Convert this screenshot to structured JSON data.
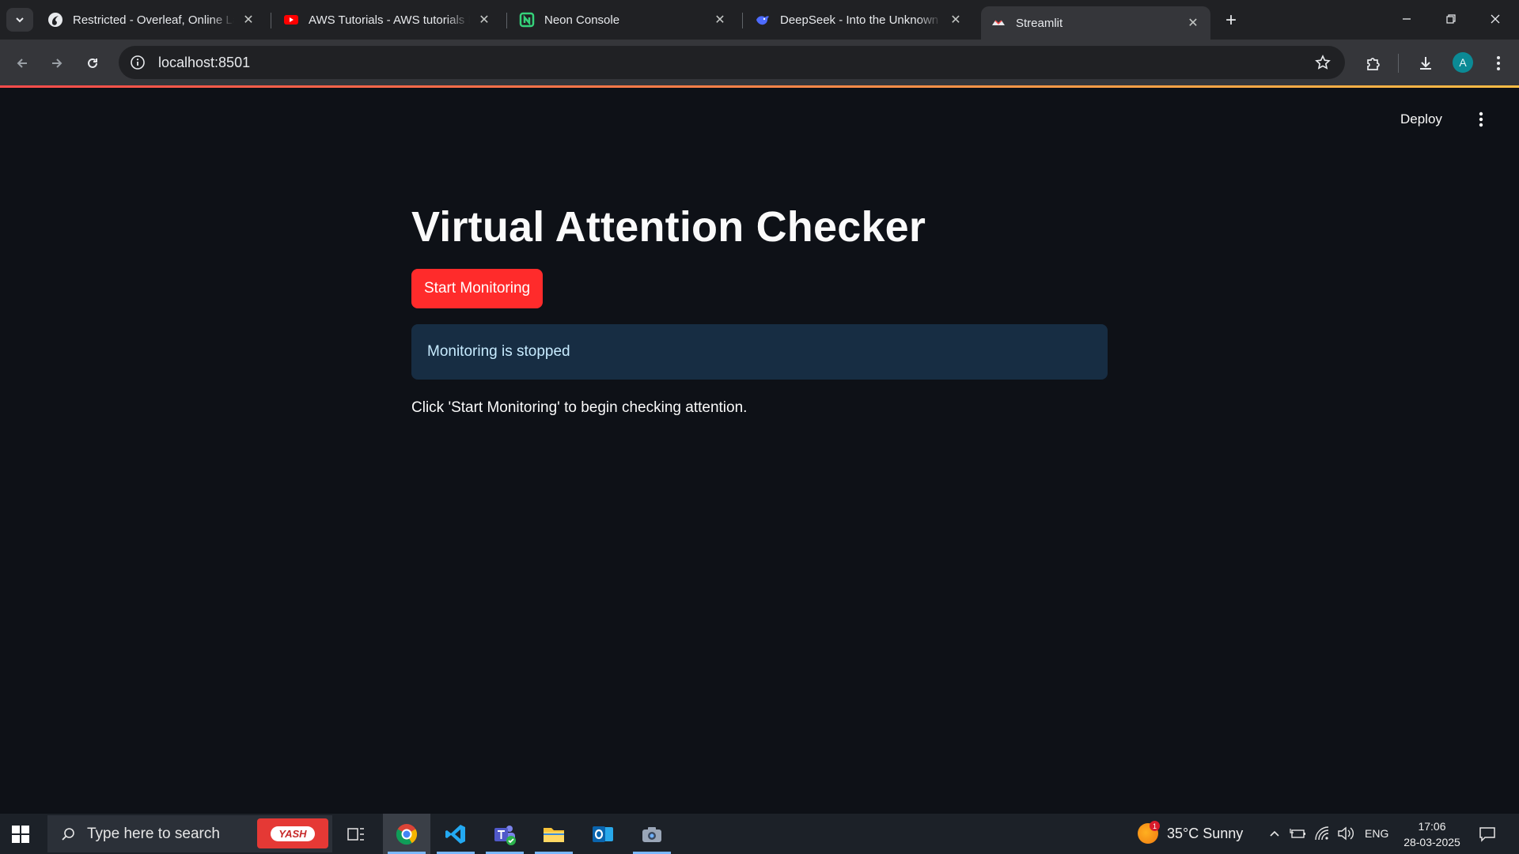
{
  "browser": {
    "tabs": [
      {
        "title": "Restricted - Overleaf, Online LaTeX Editor",
        "icon": "overleaf-icon"
      },
      {
        "title": "AWS Tutorials - AWS tutorials For Beginners",
        "icon": "youtube-icon"
      },
      {
        "title": "Neon Console",
        "icon": "neon-icon"
      },
      {
        "title": "DeepSeek - Into the Unknown",
        "icon": "deepseek-icon"
      },
      {
        "title": "Streamlit",
        "icon": "streamlit-icon",
        "active": true
      }
    ],
    "address": "localhost:8501",
    "profile_initial": "A"
  },
  "app": {
    "deploy_label": "Deploy",
    "title": "Virtual Attention Checker",
    "start_button_label": "Start Monitoring",
    "status_message": "Monitoring is stopped",
    "hint_text": "Click 'Start Monitoring' to begin checking attention."
  },
  "taskbar": {
    "search_placeholder": "Type here to search",
    "promo_label": "YASH",
    "weather": {
      "badge": "1",
      "text": "35°C  Sunny"
    },
    "language": "ENG",
    "time": "17:06",
    "date": "28-03-2025"
  },
  "colors": {
    "app_background": "#0e1117",
    "primary_button": "#ff2b2b",
    "info_background": "#172d43",
    "info_text": "#c7ebff"
  }
}
